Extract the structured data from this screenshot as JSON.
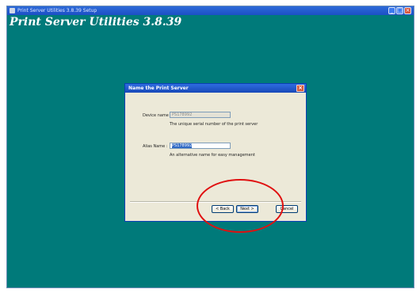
{
  "window": {
    "title": "Print Server Utilities 3.8.39 Setup",
    "heading": "Print Server Utilities 3.8.39"
  },
  "dialog": {
    "title": "Name the Print Server",
    "device_name": {
      "label": "Device name :",
      "value": "PS178992",
      "hint": "The unique serial number of the print server"
    },
    "alias_name": {
      "label": "Alias Name :",
      "value": "PS178992",
      "hint": "An alternative name for easy management"
    },
    "buttons": {
      "back": "< Back",
      "next": "Next >",
      "cancel": "Cancel"
    }
  },
  "colors": {
    "desktop": "#007a7a",
    "titlebar": "#1c4fc6",
    "dialog_bg": "#ece9d8",
    "annotation": "#e01010"
  },
  "icons": [
    "app-icon",
    "minimize-icon",
    "maximize-icon",
    "close-icon",
    "dialog-close-icon"
  ]
}
